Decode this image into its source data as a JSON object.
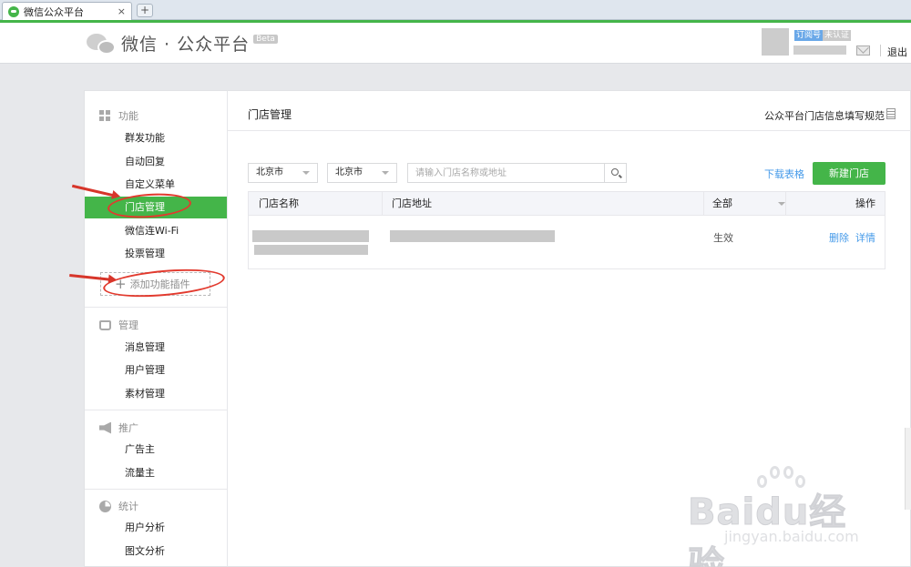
{
  "browser": {
    "tab_title": "微信公众平台",
    "tab_close": "×",
    "new_tab": "+"
  },
  "header": {
    "logo_text": "微信 · 公众平台",
    "beta": "Beta",
    "badge_subscription": "订阅号",
    "badge_unverified": "未认证",
    "logout": "退出"
  },
  "sidebar": {
    "sections": [
      {
        "title": "功能",
        "icon": "grid-icon",
        "items": [
          "群发功能",
          "自动回复",
          "自定义菜单",
          "门店管理",
          "微信连Wi-Fi",
          "投票管理"
        ]
      },
      {
        "title": "管理",
        "icon": "inbox-icon",
        "items": [
          "消息管理",
          "用户管理",
          "素材管理"
        ]
      },
      {
        "title": "推广",
        "icon": "megaphone-icon",
        "items": [
          "广告主",
          "流量主"
        ]
      },
      {
        "title": "统计",
        "icon": "pie-chart-icon",
        "items": [
          "用户分析",
          "图文分析"
        ]
      }
    ],
    "active_item": "门店管理",
    "add_plugin": "添加功能插件"
  },
  "main": {
    "title": "门店管理",
    "spec_link": "公众平台门店信息填写规范",
    "province_select": "北京市",
    "city_select": "北京市",
    "search_placeholder": "请输入门店名称或地址",
    "download_link": "下载表格",
    "new_store_button": "新建门店",
    "table": {
      "columns": [
        "门店名称",
        "门店地址",
        "全部",
        "操作"
      ],
      "rows": [
        {
          "status": "生效",
          "actions": [
            "删除",
            "详情"
          ]
        }
      ]
    }
  },
  "watermark": {
    "text": "Baidu经验",
    "sub": "jingyan.baidu.com"
  },
  "colors": {
    "accent_green": "#44b549",
    "link_blue": "#459ae9",
    "annotation_red": "#e23a2e"
  }
}
